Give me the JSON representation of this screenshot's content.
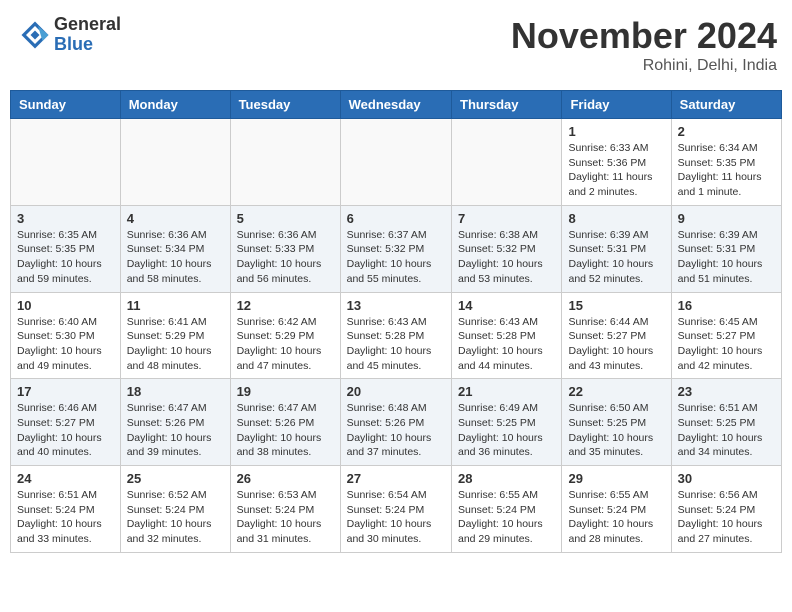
{
  "header": {
    "logo_general": "General",
    "logo_blue": "Blue",
    "month_title": "November 2024",
    "location": "Rohini, Delhi, India"
  },
  "weekdays": [
    "Sunday",
    "Monday",
    "Tuesday",
    "Wednesday",
    "Thursday",
    "Friday",
    "Saturday"
  ],
  "weeks": [
    [
      {
        "day": "",
        "info": ""
      },
      {
        "day": "",
        "info": ""
      },
      {
        "day": "",
        "info": ""
      },
      {
        "day": "",
        "info": ""
      },
      {
        "day": "",
        "info": ""
      },
      {
        "day": "1",
        "info": "Sunrise: 6:33 AM\nSunset: 5:36 PM\nDaylight: 11 hours\nand 2 minutes."
      },
      {
        "day": "2",
        "info": "Sunrise: 6:34 AM\nSunset: 5:35 PM\nDaylight: 11 hours\nand 1 minute."
      }
    ],
    [
      {
        "day": "3",
        "info": "Sunrise: 6:35 AM\nSunset: 5:35 PM\nDaylight: 10 hours\nand 59 minutes."
      },
      {
        "day": "4",
        "info": "Sunrise: 6:36 AM\nSunset: 5:34 PM\nDaylight: 10 hours\nand 58 minutes."
      },
      {
        "day": "5",
        "info": "Sunrise: 6:36 AM\nSunset: 5:33 PM\nDaylight: 10 hours\nand 56 minutes."
      },
      {
        "day": "6",
        "info": "Sunrise: 6:37 AM\nSunset: 5:32 PM\nDaylight: 10 hours\nand 55 minutes."
      },
      {
        "day": "7",
        "info": "Sunrise: 6:38 AM\nSunset: 5:32 PM\nDaylight: 10 hours\nand 53 minutes."
      },
      {
        "day": "8",
        "info": "Sunrise: 6:39 AM\nSunset: 5:31 PM\nDaylight: 10 hours\nand 52 minutes."
      },
      {
        "day": "9",
        "info": "Sunrise: 6:39 AM\nSunset: 5:31 PM\nDaylight: 10 hours\nand 51 minutes."
      }
    ],
    [
      {
        "day": "10",
        "info": "Sunrise: 6:40 AM\nSunset: 5:30 PM\nDaylight: 10 hours\nand 49 minutes."
      },
      {
        "day": "11",
        "info": "Sunrise: 6:41 AM\nSunset: 5:29 PM\nDaylight: 10 hours\nand 48 minutes."
      },
      {
        "day": "12",
        "info": "Sunrise: 6:42 AM\nSunset: 5:29 PM\nDaylight: 10 hours\nand 47 minutes."
      },
      {
        "day": "13",
        "info": "Sunrise: 6:43 AM\nSunset: 5:28 PM\nDaylight: 10 hours\nand 45 minutes."
      },
      {
        "day": "14",
        "info": "Sunrise: 6:43 AM\nSunset: 5:28 PM\nDaylight: 10 hours\nand 44 minutes."
      },
      {
        "day": "15",
        "info": "Sunrise: 6:44 AM\nSunset: 5:27 PM\nDaylight: 10 hours\nand 43 minutes."
      },
      {
        "day": "16",
        "info": "Sunrise: 6:45 AM\nSunset: 5:27 PM\nDaylight: 10 hours\nand 42 minutes."
      }
    ],
    [
      {
        "day": "17",
        "info": "Sunrise: 6:46 AM\nSunset: 5:27 PM\nDaylight: 10 hours\nand 40 minutes."
      },
      {
        "day": "18",
        "info": "Sunrise: 6:47 AM\nSunset: 5:26 PM\nDaylight: 10 hours\nand 39 minutes."
      },
      {
        "day": "19",
        "info": "Sunrise: 6:47 AM\nSunset: 5:26 PM\nDaylight: 10 hours\nand 38 minutes."
      },
      {
        "day": "20",
        "info": "Sunrise: 6:48 AM\nSunset: 5:26 PM\nDaylight: 10 hours\nand 37 minutes."
      },
      {
        "day": "21",
        "info": "Sunrise: 6:49 AM\nSunset: 5:25 PM\nDaylight: 10 hours\nand 36 minutes."
      },
      {
        "day": "22",
        "info": "Sunrise: 6:50 AM\nSunset: 5:25 PM\nDaylight: 10 hours\nand 35 minutes."
      },
      {
        "day": "23",
        "info": "Sunrise: 6:51 AM\nSunset: 5:25 PM\nDaylight: 10 hours\nand 34 minutes."
      }
    ],
    [
      {
        "day": "24",
        "info": "Sunrise: 6:51 AM\nSunset: 5:24 PM\nDaylight: 10 hours\nand 33 minutes."
      },
      {
        "day": "25",
        "info": "Sunrise: 6:52 AM\nSunset: 5:24 PM\nDaylight: 10 hours\nand 32 minutes."
      },
      {
        "day": "26",
        "info": "Sunrise: 6:53 AM\nSunset: 5:24 PM\nDaylight: 10 hours\nand 31 minutes."
      },
      {
        "day": "27",
        "info": "Sunrise: 6:54 AM\nSunset: 5:24 PM\nDaylight: 10 hours\nand 30 minutes."
      },
      {
        "day": "28",
        "info": "Sunrise: 6:55 AM\nSunset: 5:24 PM\nDaylight: 10 hours\nand 29 minutes."
      },
      {
        "day": "29",
        "info": "Sunrise: 6:55 AM\nSunset: 5:24 PM\nDaylight: 10 hours\nand 28 minutes."
      },
      {
        "day": "30",
        "info": "Sunrise: 6:56 AM\nSunset: 5:24 PM\nDaylight: 10 hours\nand 27 minutes."
      }
    ]
  ]
}
